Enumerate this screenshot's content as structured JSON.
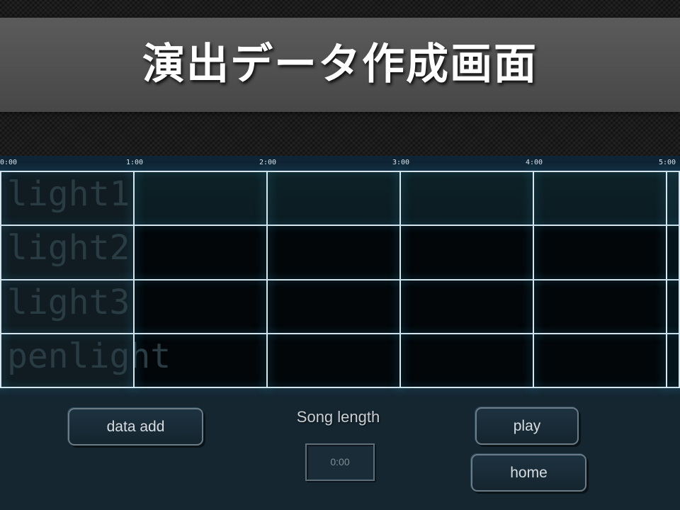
{
  "header": {
    "title": "演出データ作成画面"
  },
  "timeline": {
    "ticks": [
      "0:00",
      "1:00",
      "2:00",
      "3:00",
      "4:00",
      "5:00"
    ]
  },
  "tracks": [
    {
      "label": "light1"
    },
    {
      "label": "light2"
    },
    {
      "label": "light3"
    },
    {
      "label": "penlight"
    }
  ],
  "controls": {
    "data_add_label": "data add",
    "song_length_label": "Song length",
    "song_length_value": "0:00",
    "play_label": "play",
    "home_label": "home"
  },
  "colors": {
    "background": "#152631",
    "grid_line": "#d6e6ee",
    "title_band": "#4f4f4f"
  }
}
